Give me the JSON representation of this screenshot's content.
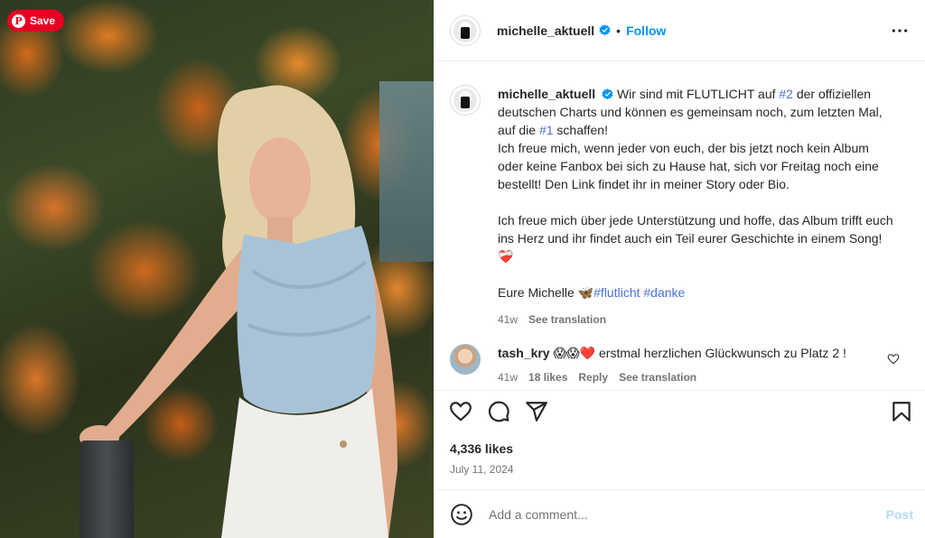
{
  "pin": {
    "save_label": "Save",
    "logo_glyph": "P"
  },
  "post": {
    "username": "michelle_aktuell",
    "follow_label": "Follow",
    "separator": "•",
    "caption": {
      "l1_a": " Wir sind mit FLUTLICHT auf ",
      "l1_tag": "#2",
      "l1_b": " der offiziellen deutschen Charts und können es gemeinsam noch, zum letzten Mal, auf die ",
      "l1_tag2": "#1",
      "l1_c": " schaffen!",
      "p2": "Ich freue mich, wenn jeder von euch, der bis jetzt noch kein Album oder keine Fanbox bei sich zu Hause hat, sich vor Freitag noch eine bestellt! Den Link findet ihr in meiner Story oder Bio.",
      "p3": "Ich freue mich über jede Unterstützung und hoffe, das Album trifft euch ins Herz und ihr findet auch ein Teil eurer Geschichte in einem Song! ",
      "p3_emoji": "❤️‍🩹",
      "p4": "Eure Michelle ",
      "p4_emoji": "🦋",
      "hash1": "#flutlicht",
      "hash2": "#danke"
    },
    "caption_meta": {
      "age": "41w",
      "translate": "See translation"
    },
    "comment": {
      "username": "tash_kry",
      "emojis": "😱😱❤️",
      "text": " erstmal herzlichen Glückwunsch zu Platz 2 !",
      "age": "41w",
      "likes": "18 likes",
      "reply": "Reply",
      "translate": "See translation"
    },
    "likes": "4,336 likes",
    "date": "July 11, 2024",
    "add_comment_placeholder": "Add a comment...",
    "post_label": "Post"
  },
  "colors": {
    "accent": "#0095f6",
    "pinterest": "#e60023",
    "hashtag": "#4a6fd8"
  },
  "icons": [
    "pinterest-icon",
    "verified-icon",
    "more-icon",
    "heart-icon",
    "comment-icon",
    "share-icon",
    "bookmark-icon",
    "emoji-icon"
  ]
}
